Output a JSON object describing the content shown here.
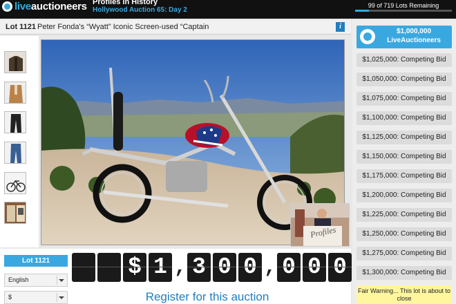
{
  "header": {
    "logo_prefix": "live",
    "logo_main": "auctioneers",
    "auction_title": "Profiles in History",
    "auction_subtitle": "Hollywood Auction 65: Day 2",
    "lots_remaining": "99 of 719 Lots Remaining",
    "progress_fraction": 0.14
  },
  "lot": {
    "number": "Lot 1121",
    "description": "Peter Fonda's “Wyatt” Iconic Screen-used “Captain",
    "info_label": "i"
  },
  "thumbnails": [
    "jacket-thumb",
    "suit-thumb",
    "pants-thumb",
    "jeans-thumb",
    "bicycle-thumb",
    "book-thumb"
  ],
  "webcam": {
    "caption": "Profiles"
  },
  "controls": {
    "lot_pill": "Lot 1121",
    "language": "English",
    "currency": "$"
  },
  "price": {
    "glyphs": [
      "",
      "",
      "$",
      "1",
      ",",
      "3",
      "0",
      "0",
      ",",
      "0",
      "0",
      "0"
    ]
  },
  "register_label": "Register for this auction",
  "bids": {
    "current_amount": "$1,000,000",
    "current_source": "LiveAuctioneers",
    "competing": [
      "$1,025,000: Competing Bid",
      "$1,050,000: Competing Bid",
      "$1,075,000: Competing Bid",
      "$1,100,000: Competing Bid",
      "$1,125,000: Competing Bid",
      "$1,150,000: Competing Bid",
      "$1,175,000: Competing Bid",
      "$1,200,000: Competing Bid",
      "$1,225,000: Competing Bid",
      "$1,250,000: Competing Bid",
      "$1,275,000: Competing Bid",
      "$1,300,000: Competing Bid"
    ]
  },
  "warning": "Fair Warning... This lot is about to close",
  "colors": {
    "accent": "#3aa8e0",
    "link": "#1f7ec1",
    "warning": "#fff69e",
    "header": "#111111"
  }
}
